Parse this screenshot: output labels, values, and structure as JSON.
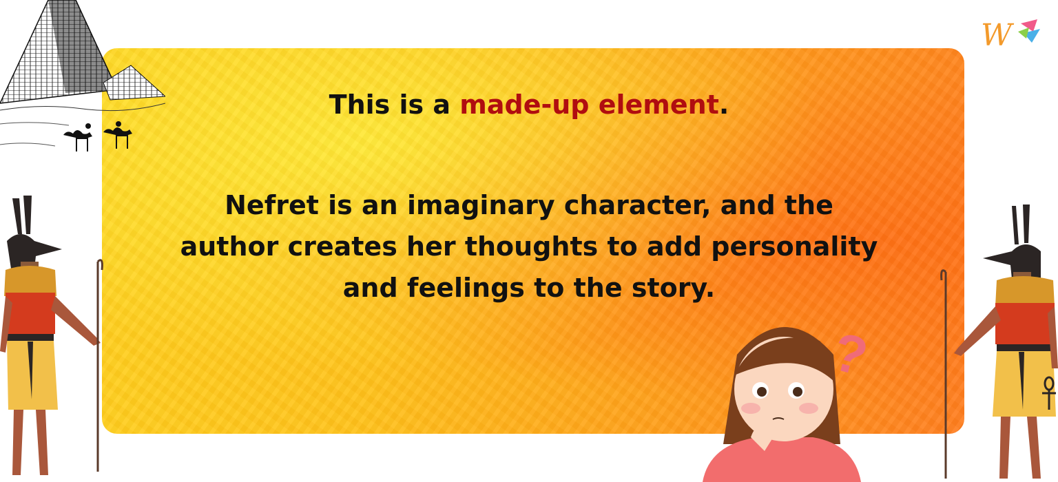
{
  "logo": {
    "letter": "W",
    "icon": "w-brand-logo"
  },
  "headline": {
    "prefix": "This is a ",
    "highlight": "made-up element",
    "suffix": "."
  },
  "body": {
    "line1": "Nefret is an imaginary character, and the",
    "line2": "author creates her thoughts to add personality",
    "line3": "and feelings to the story."
  },
  "illustrations": {
    "top_left": "pyramids-with-camel-riders",
    "left": "egyptian-god-with-staff",
    "right": "egyptian-god-with-ankh",
    "bottom": "thinking-girl",
    "mark": "?"
  },
  "colors": {
    "highlight": "#b00d10",
    "card_start": "#ffd21e",
    "card_end": "#ff7d1e",
    "question_mark": "#f06b78"
  }
}
